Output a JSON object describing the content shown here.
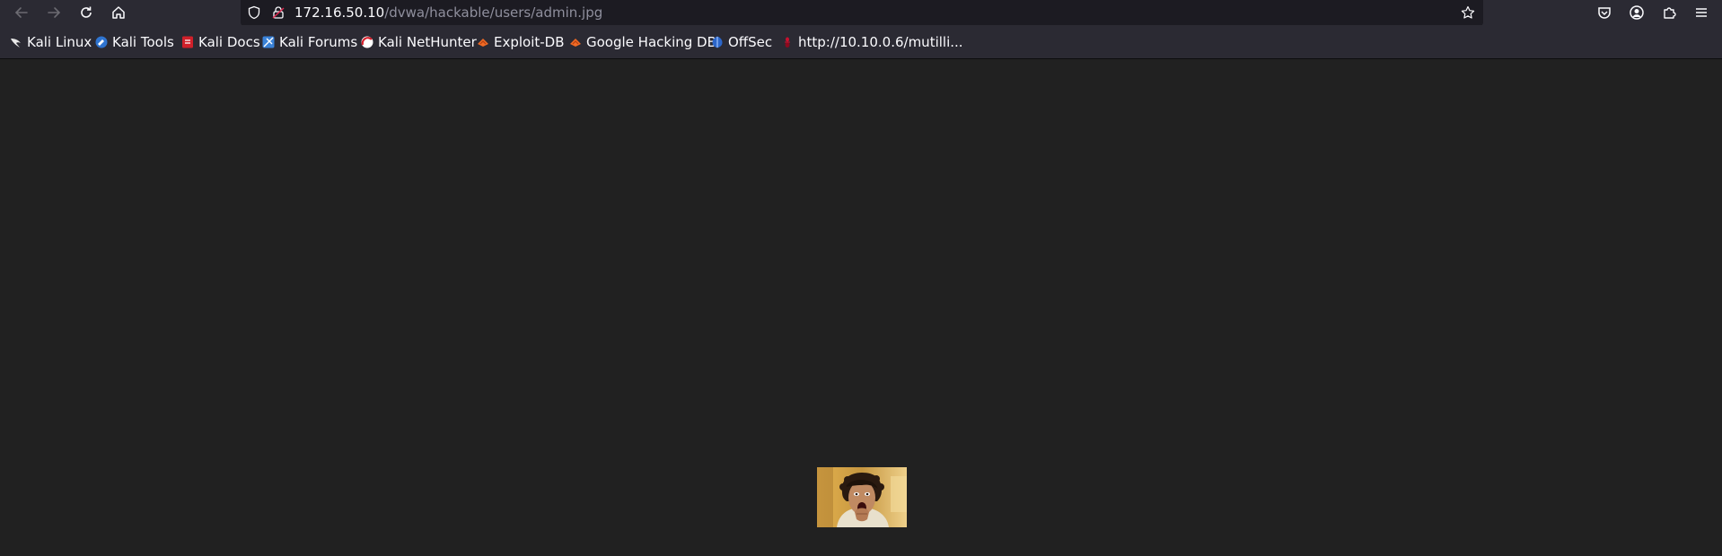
{
  "window": {
    "url": {
      "host": "172.16.50.10",
      "path": "/dvwa/hackable/users/admin.jpg"
    }
  },
  "bookmarks": [
    {
      "label": "Kali Linux",
      "icon": "kali-dragon-icon"
    },
    {
      "label": "Kali Tools",
      "icon": "kali-tools-icon"
    },
    {
      "label": "Kali Docs",
      "icon": "kali-docs-icon"
    },
    {
      "label": "Kali Forums",
      "icon": "kali-forums-icon"
    },
    {
      "label": "Kali NetHunter",
      "icon": "kali-nethunter-icon"
    },
    {
      "label": "Exploit-DB",
      "icon": "exploit-db-icon"
    },
    {
      "label": "Google Hacking DB",
      "icon": "exploit-db-icon"
    },
    {
      "label": "OffSec",
      "icon": "offsec-icon"
    },
    {
      "label": "http://10.10.0.6/mutilli...",
      "icon": "mutillidae-icon"
    }
  ],
  "toolbar": {
    "icons": [
      "back-icon",
      "forward-icon",
      "reload-icon",
      "home-icon",
      "shield-icon",
      "lock-icon",
      "star-icon",
      "pocket-icon",
      "account-icon",
      "extensions-icon",
      "menu-icon"
    ]
  },
  "colors": {
    "toolbar_bg": "#2b2a33",
    "urlbar_bg": "#1c1b22",
    "page_bg": "#212121"
  }
}
